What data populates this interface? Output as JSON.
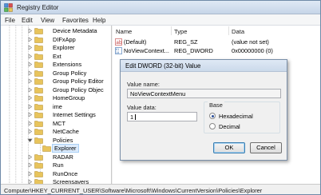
{
  "window": {
    "title": "Registry Editor"
  },
  "menu": [
    "File",
    "Edit",
    "View",
    "Favorites",
    "Help"
  ],
  "tree": {
    "items": [
      {
        "label": "Device Metadata"
      },
      {
        "label": "DIFxApp"
      },
      {
        "label": "Explorer"
      },
      {
        "label": "Ext"
      },
      {
        "label": "Extensions"
      },
      {
        "label": "Group Policy"
      },
      {
        "label": "Group Policy Editor"
      },
      {
        "label": "Group Policy Objec"
      },
      {
        "label": "HomeGroup"
      },
      {
        "label": "ime"
      },
      {
        "label": "Internet Settings"
      },
      {
        "label": "MCT"
      },
      {
        "label": "NetCache"
      },
      {
        "label": "Policies"
      },
      {
        "label": "Explorer"
      },
      {
        "label": "RADAR"
      },
      {
        "label": "Run"
      },
      {
        "label": "RunOnce"
      },
      {
        "label": "Screensavers"
      }
    ]
  },
  "values": {
    "headers": {
      "name": "Name",
      "type": "Type",
      "data": "Data"
    },
    "rows": [
      {
        "name": "(Default)",
        "type": "REG_SZ",
        "data": "(value not set)",
        "icon": "string-value-icon"
      },
      {
        "name": "NoViewContext...",
        "type": "REG_DWORD",
        "data": "0x00000000 (0)",
        "icon": "binary-value-icon"
      }
    ]
  },
  "dialog": {
    "title": "Edit DWORD (32-bit) Value",
    "value_name_label": "Value name:",
    "value_name": "NoViewContextMenu",
    "value_data_label": "Value data:",
    "value_data": "1",
    "base_label": "Base",
    "hex_label": "Hexadecimal",
    "dec_label": "Decimal",
    "selected_base": "Hexadecimal",
    "ok_label": "OK",
    "cancel_label": "Cancel"
  },
  "status": {
    "path": "Computer\\HKEY_CURRENT_USER\\Software\\Microsoft\\Windows\\CurrentVersion\\Policies\\Explorer"
  },
  "colors": {
    "folder": "#e8c45c",
    "selection": "#dcebfc",
    "title_gradient": "#dfe9f5",
    "accent": "#3c7fb1"
  }
}
